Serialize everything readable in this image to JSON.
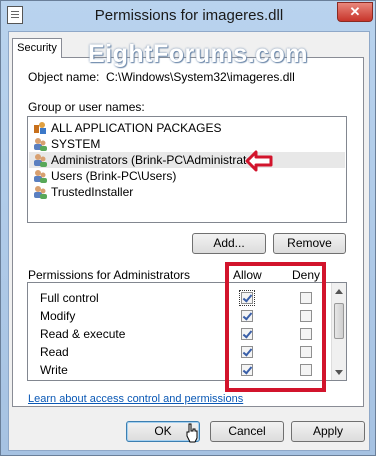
{
  "window": {
    "title": "Permissions for imageres.dll",
    "close_label": "✕"
  },
  "watermark": "EightForums.com",
  "tab": {
    "label": "Security"
  },
  "object": {
    "label": "Object name:",
    "value": "C:\\Windows\\System32\\imageres.dll"
  },
  "groups": {
    "label": "Group or user names:",
    "items": [
      {
        "label": "ALL APPLICATION PACKAGES",
        "icon": "app-packages-icon"
      },
      {
        "label": "SYSTEM",
        "icon": "users-icon"
      },
      {
        "label": "Administrators (Brink-PC\\Administrators)",
        "icon": "users-icon",
        "selected": true
      },
      {
        "label": "Users (Brink-PC\\Users)",
        "icon": "users-icon"
      },
      {
        "label": "TrustedInstaller",
        "icon": "users-icon"
      }
    ]
  },
  "buttons": {
    "add": "Add...",
    "remove": "Remove",
    "ok": "OK",
    "cancel": "Cancel",
    "apply": "Apply"
  },
  "permissions": {
    "label": "Permissions for Administrators",
    "allow_header": "Allow",
    "deny_header": "Deny",
    "rows": [
      {
        "label": "Full control",
        "allow": true,
        "deny": false
      },
      {
        "label": "Modify",
        "allow": true,
        "deny": false
      },
      {
        "label": "Read & execute",
        "allow": true,
        "deny": false
      },
      {
        "label": "Read",
        "allow": true,
        "deny": false
      },
      {
        "label": "Write",
        "allow": true,
        "deny": false
      }
    ]
  },
  "link": "Learn about access control and permissions",
  "colors": {
    "annotation": "#d2142c",
    "link": "#0a58b5"
  }
}
